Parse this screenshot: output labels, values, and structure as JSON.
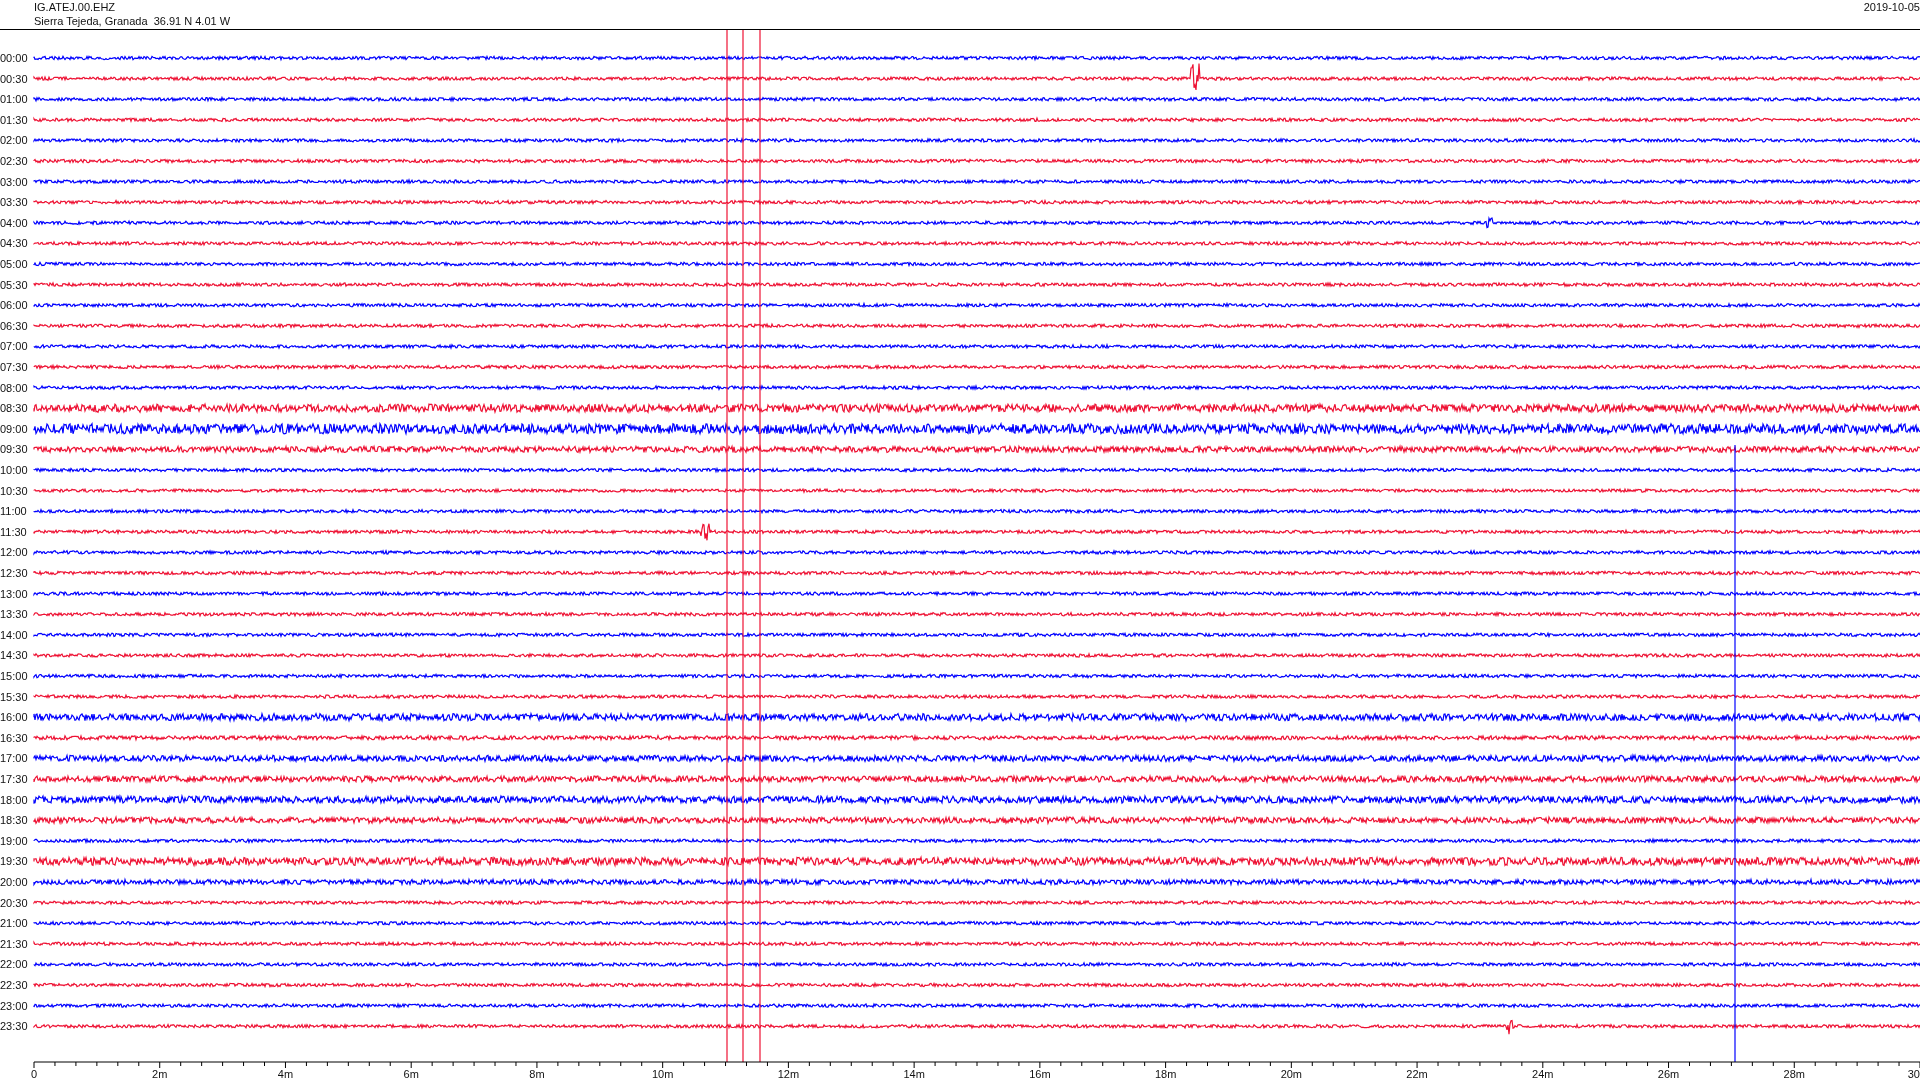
{
  "header": {
    "station": "IG.ATEJ.00.EHZ",
    "location": "Sierra Tejeda, Granada  36.91 N 4.01 W",
    "date": "2019-10-05"
  },
  "rows": [
    {
      "label": "00:00",
      "color": "#0000ff"
    },
    {
      "label": "00:30",
      "color": "#ee1133"
    },
    {
      "label": "01:00",
      "color": "#0000ff"
    },
    {
      "label": "01:30",
      "color": "#ee1133"
    },
    {
      "label": "02:00",
      "color": "#0000ff"
    },
    {
      "label": "02:30",
      "color": "#ee1133"
    },
    {
      "label": "03:00",
      "color": "#0000ff"
    },
    {
      "label": "03:30",
      "color": "#ee1133"
    },
    {
      "label": "04:00",
      "color": "#0000ff"
    },
    {
      "label": "04:30",
      "color": "#ee1133"
    },
    {
      "label": "05:00",
      "color": "#0000ff"
    },
    {
      "label": "05:30",
      "color": "#ee1133"
    },
    {
      "label": "06:00",
      "color": "#0000ff"
    },
    {
      "label": "06:30",
      "color": "#ee1133"
    },
    {
      "label": "07:00",
      "color": "#0000ff"
    },
    {
      "label": "07:30",
      "color": "#ee1133"
    },
    {
      "label": "08:00",
      "color": "#0000ff"
    },
    {
      "label": "08:30",
      "color": "#ee1133"
    },
    {
      "label": "09:00",
      "color": "#0000ff"
    },
    {
      "label": "09:30",
      "color": "#ee1133"
    },
    {
      "label": "10:00",
      "color": "#0000ff"
    },
    {
      "label": "10:30",
      "color": "#ee1133"
    },
    {
      "label": "11:00",
      "color": "#0000ff"
    },
    {
      "label": "11:30",
      "color": "#ee1133"
    },
    {
      "label": "12:00",
      "color": "#0000ff"
    },
    {
      "label": "12:30",
      "color": "#ee1133"
    },
    {
      "label": "13:00",
      "color": "#0000ff"
    },
    {
      "label": "13:30",
      "color": "#ee1133"
    },
    {
      "label": "14:00",
      "color": "#0000ff"
    },
    {
      "label": "14:30",
      "color": "#ee1133"
    },
    {
      "label": "15:00",
      "color": "#0000ff"
    },
    {
      "label": "15:30",
      "color": "#ee1133"
    },
    {
      "label": "16:00",
      "color": "#0000ff"
    },
    {
      "label": "16:30",
      "color": "#ee1133"
    },
    {
      "label": "17:00",
      "color": "#0000ff"
    },
    {
      "label": "17:30",
      "color": "#ee1133"
    },
    {
      "label": "18:00",
      "color": "#0000ff"
    },
    {
      "label": "18:30",
      "color": "#ee1133"
    },
    {
      "label": "19:00",
      "color": "#0000ff"
    },
    {
      "label": "19:30",
      "color": "#ee1133"
    },
    {
      "label": "20:00",
      "color": "#0000ff"
    },
    {
      "label": "20:30",
      "color": "#ee1133"
    },
    {
      "label": "21:00",
      "color": "#0000ff"
    },
    {
      "label": "21:30",
      "color": "#ee1133"
    },
    {
      "label": "22:00",
      "color": "#0000ff"
    },
    {
      "label": "22:30",
      "color": "#ee1133"
    },
    {
      "label": "23:00",
      "color": "#0000ff"
    },
    {
      "label": "23:30",
      "color": "#ee1133"
    }
  ],
  "x_axis": {
    "labels": [
      "0",
      "2m",
      "4m",
      "6m",
      "8m",
      "10m",
      "12m",
      "14m",
      "16m",
      "18m",
      "20m",
      "22m",
      "24m",
      "26m",
      "28m",
      "30"
    ]
  }
}
